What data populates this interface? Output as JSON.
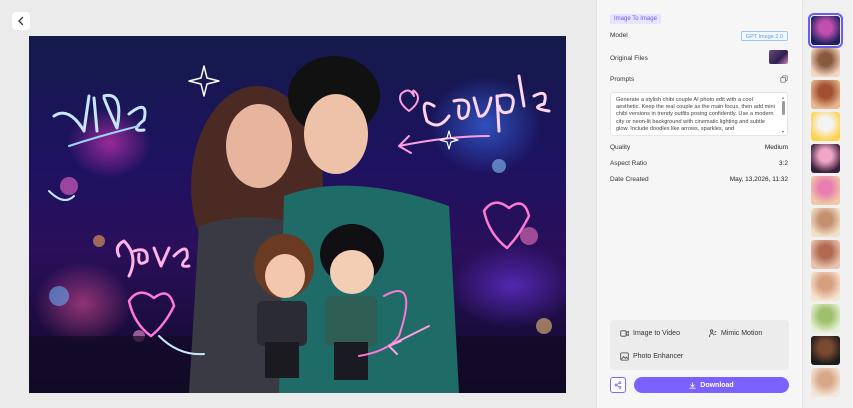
{
  "image_panel": {
    "back_icon": "chevron-left-icon",
    "overlay_texts": {
      "vibe": "vibe",
      "couple": "couple",
      "love": "love"
    }
  },
  "details": {
    "tag": "Image To Image",
    "model": {
      "label": "Model",
      "value": "GPT Image 2.0"
    },
    "original_files": {
      "label": "Original Files"
    },
    "prompts": {
      "label": "Prompts",
      "text": "Generate a stylish chibi couple AI photo edit with a cool aesthetic. Keep the real couple as the main focus, then add mini chibi versions in trendy outfits posing confidently. Use a modern city or neon-lit background with cinematic lighting and subtle glow. Include doodles like arrows, sparkles, and"
    },
    "quality": {
      "label": "Quality",
      "value": "Medium"
    },
    "aspect_ratio": {
      "label": "Aspect Ratio",
      "value": "3:2"
    },
    "date_created": {
      "label": "Date Created",
      "value": "May, 13,2026, 11:32"
    }
  },
  "actions": {
    "image_to_video": "Image to Video",
    "mimic_motion": "Mimic Motion",
    "photo_enhancer": "Photo Enhancer"
  },
  "footer": {
    "download_label": "Download"
  },
  "thumbnails": {
    "count": 12,
    "selected_index": 0
  },
  "colors": {
    "accent": "#7b61ff",
    "badge_bg": "#e7e4fd",
    "model_chip": "#5aa0e6"
  }
}
